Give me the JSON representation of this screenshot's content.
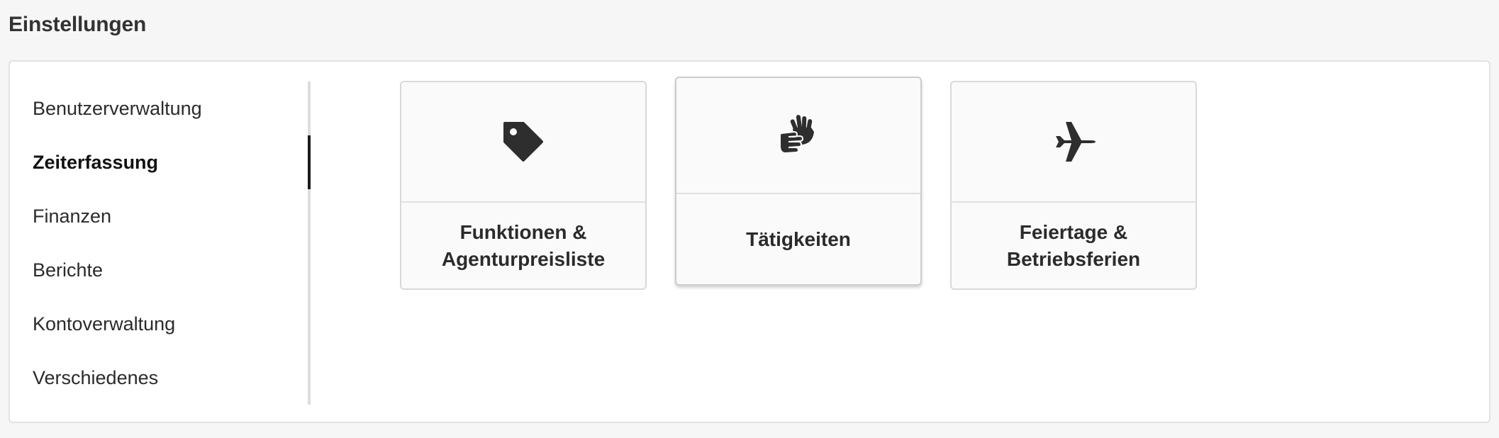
{
  "page": {
    "title": "Einstellungen"
  },
  "sidebar": {
    "items": [
      {
        "label": "Benutzerverwaltung",
        "active": false
      },
      {
        "label": "Zeiterfassung",
        "active": true
      },
      {
        "label": "Finanzen",
        "active": false
      },
      {
        "label": "Berichte",
        "active": false
      },
      {
        "label": "Kontoverwaltung",
        "active": false
      },
      {
        "label": "Verschiedenes",
        "active": false
      }
    ]
  },
  "cards": [
    {
      "icon": "tag-icon",
      "label_line1": "Funktionen &",
      "label_line2": "Agenturpreisliste"
    },
    {
      "icon": "hands-icon",
      "label_line1": "Tätigkeiten",
      "label_line2": ""
    },
    {
      "icon": "airplane-icon",
      "label_line1": "Feiertage &",
      "label_line2": "Betriebsferien"
    }
  ],
  "colors": {
    "background": "#f6f6f6",
    "panel": "#ffffff",
    "text": "#2b2b2b",
    "active_marker": "#1b1b1b"
  }
}
